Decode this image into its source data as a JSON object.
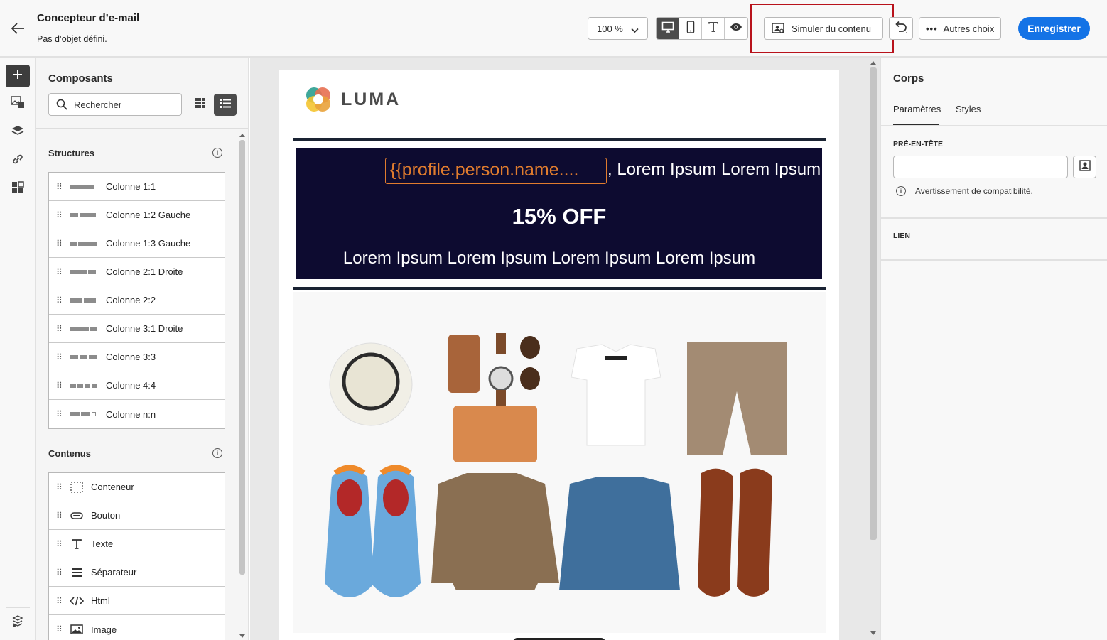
{
  "header": {
    "title": "Concepteur d’e-mail",
    "subtitle": "Pas d’objet défini.",
    "zoom": "100 %",
    "simulate_label": "Simuler du contenu",
    "more_label": "Autres choix",
    "save_label": "Enregistrer",
    "devices": [
      "desktop-icon",
      "mobile-icon",
      "text-icon",
      "eye-icon"
    ],
    "active_device": "desktop-icon"
  },
  "rail": {
    "items": [
      "plus-icon",
      "assets-icon",
      "layers-icon",
      "link-icon",
      "fragments-icon"
    ],
    "active": "plus-icon",
    "bottom": "layers-settings-icon"
  },
  "components": {
    "title": "Composants",
    "search_placeholder": "Rechercher",
    "active_view": "list",
    "structures_title": "Structures",
    "structures": [
      {
        "label": "Colonne 1:1",
        "cols": [
          1
        ]
      },
      {
        "label": "Colonne 1:2 Gauche",
        "cols": [
          1,
          2
        ]
      },
      {
        "label": "Colonne 1:3 Gauche",
        "cols": [
          1,
          3
        ]
      },
      {
        "label": "Colonne 2:1 Droite",
        "cols": [
          2,
          1
        ]
      },
      {
        "label": "Colonne 2:2",
        "cols": [
          1,
          1
        ]
      },
      {
        "label": "Colonne 3:1 Droite",
        "cols": [
          3,
          1
        ]
      },
      {
        "label": "Colonne 3:3",
        "cols": [
          1,
          1,
          1
        ]
      },
      {
        "label": "Colonne 4:4",
        "cols": [
          1,
          1,
          1,
          1
        ]
      },
      {
        "label": "Colonne n:n",
        "cols": [
          1,
          1,
          "+"
        ]
      }
    ],
    "contents_title": "Contenus",
    "contents": [
      {
        "label": "Conteneur",
        "icon": "container-icon"
      },
      {
        "label": "Bouton",
        "icon": "button-icon"
      },
      {
        "label": "Texte",
        "icon": "text-icon"
      },
      {
        "label": "Séparateur",
        "icon": "divider-icon"
      },
      {
        "label": "Html",
        "icon": "code-icon"
      },
      {
        "label": "Image",
        "icon": "image-icon"
      }
    ]
  },
  "email": {
    "logo_text": "LUMA",
    "token": "{{profile.person.name....",
    "line1": ", Lorem Ipsum Lorem Ipsum",
    "offer": "15% OFF",
    "line3": "Lorem Ipsum Lorem Ipsum Lorem Ipsum Lorem Ipsum",
    "colors": {
      "hero_bg": "#0d0b30",
      "token": "#e07c2e",
      "rule": "#1a2333",
      "accent": "#1473e6"
    }
  },
  "right": {
    "title": "Corps",
    "tabs": [
      "Paramètres",
      "Styles"
    ],
    "active_tab": "Paramètres",
    "preheader_label": "PRÉ-EN-TÊTE",
    "preheader_value": "",
    "warning": "Avertissement de compatibilité.",
    "link_label": "LIEN"
  }
}
